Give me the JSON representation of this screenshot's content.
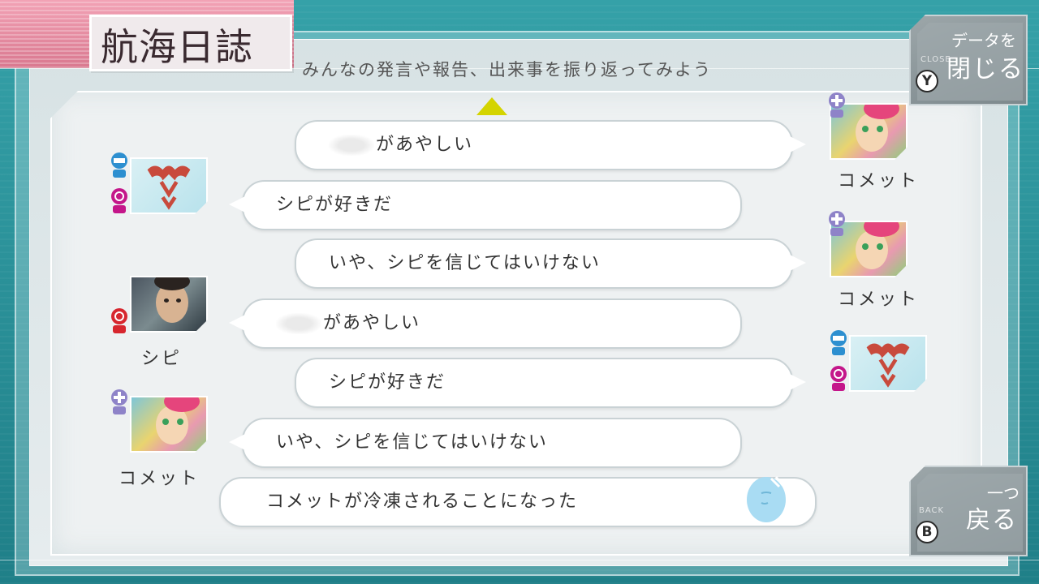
{
  "window": {
    "title": "航海日誌",
    "subtitle": "みんなの発言や報告、出来事を振り返ってみよう"
  },
  "buttons": {
    "close": {
      "line1": "データを",
      "line2": "閉じる",
      "key": "Y",
      "code": "CLOSE"
    },
    "back": {
      "line1": "一つ",
      "line2": "戻る",
      "key": "B",
      "code": "BACK"
    }
  },
  "log": {
    "entries": [
      {
        "text": "があやしい",
        "redacted_prefix": true,
        "speaker": "コメット",
        "side": "right",
        "portrait": "comet"
      },
      {
        "text": "シピが好きだ",
        "redacted_prefix": false,
        "speaker": "",
        "side": "left",
        "portrait": "sigil"
      },
      {
        "text": "いや、シピを信じてはいけない",
        "redacted_prefix": false,
        "speaker": "コメット",
        "side": "right",
        "portrait": "comet"
      },
      {
        "text": "があやしい",
        "redacted_prefix": true,
        "speaker": "シピ",
        "side": "left",
        "portrait": "sipi"
      },
      {
        "text": "シピが好きだ",
        "redacted_prefix": false,
        "speaker": "",
        "side": "right",
        "portrait": "sigil"
      },
      {
        "text": "いや、シピを信じてはいけない",
        "redacted_prefix": false,
        "speaker": "コメット",
        "side": "left",
        "portrait": "comet"
      },
      {
        "text": "コメットが冷凍されることになった",
        "redacted_prefix": false,
        "speaker": "",
        "side": "event",
        "portrait": ""
      }
    ]
  },
  "colors": {
    "scroll_arrow": "#d4d400",
    "title_band": "#e58aa0",
    "role_blue": "#2d8fd0",
    "role_magenta": "#c4168a",
    "role_red": "#d7262e",
    "role_purple": "#8e83c8"
  },
  "icons": {
    "scroll": "triangle-up-icon",
    "role_engineer": "engineer-icon",
    "role_doctor": "doctor-icon",
    "role_guardian": "guardian-icon",
    "event": "frozen-head-icon"
  }
}
